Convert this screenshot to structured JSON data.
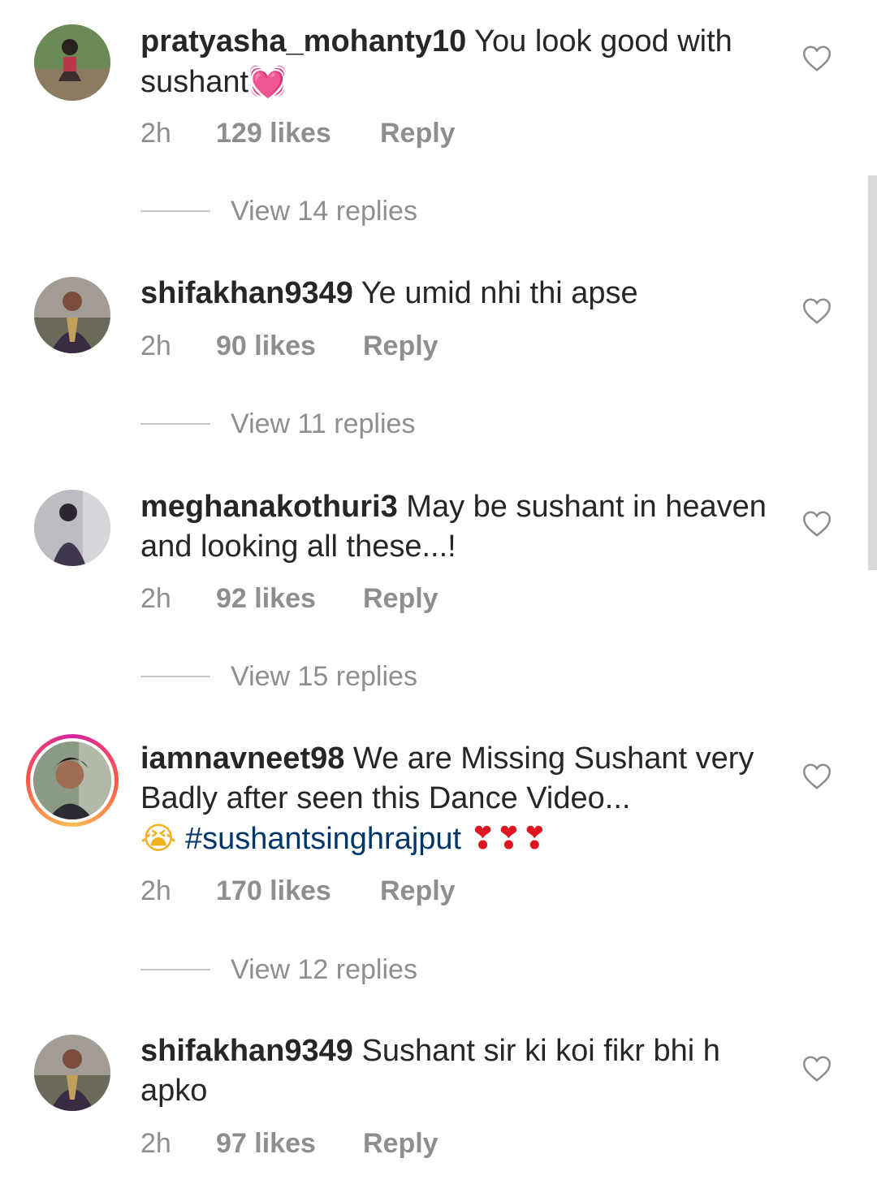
{
  "comments": [
    {
      "username": "pratyasha_mohanty10",
      "text": " You look good with sushant",
      "emoji": "💓",
      "time": "2h",
      "likes": "129 likes",
      "reply": "Reply",
      "view_replies": "View 14 replies"
    },
    {
      "username": "shifakhan9349",
      "text": " Ye umid nhi thi apse",
      "time": "2h",
      "likes": "90 likes",
      "reply": "Reply",
      "view_replies": "View 11 replies"
    },
    {
      "username": "meghanakothuri3",
      "text": " May be sushant in heaven and looking all these...!",
      "time": "2h",
      "likes": "92 likes",
      "reply": "Reply",
      "view_replies": "View 15 replies"
    },
    {
      "username": "iamnavneet98",
      "text": " We are Missing Sushant very Badly after seen this Dance Video...",
      "emoji_cry": "😭",
      "hashtag": "#sushantsinghrajput",
      "emoji_hearts": "❣❣❣",
      "time": "2h",
      "likes": "170 likes",
      "reply": "Reply",
      "view_replies": "View 12 replies",
      "has_story_ring": true
    },
    {
      "username": "shifakhan9349",
      "text": " Sushant sir ki koi fikr bhi h apko",
      "time": "2h",
      "likes": "97 likes",
      "reply": "Reply"
    }
  ]
}
